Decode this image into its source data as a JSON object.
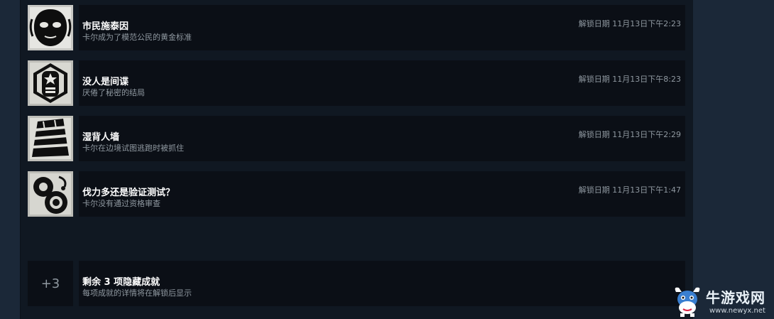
{
  "achievements": [
    {
      "title": "市民施泰因",
      "description": "卡尔成为了模范公民的黄金标准",
      "unlock_date": "解锁日期 11月13日下午2:23",
      "icon": "mask-face-icon"
    },
    {
      "title": "没人是间谍",
      "description": "厌倦了秘密的结局",
      "unlock_date": "解锁日期 11月13日下午8:23",
      "icon": "star-badge-icon"
    },
    {
      "title": "湿背人墙",
      "description": "卡尔在边境试图逃跑时被抓住",
      "unlock_date": "解锁日期 11月13日下午2:29",
      "icon": "striped-wall-icon"
    },
    {
      "title": "伐力多还是验证测试？",
      "description": "卡尔没有通过资格审查",
      "unlock_date": "解锁日期 11月13日下午1:47",
      "icon": "gears-icon"
    }
  ],
  "hidden": {
    "count": "+3",
    "title": "剩余 3 项隐藏成就",
    "description": "每项成就的详情将在解锁后显示"
  },
  "watermark": {
    "brand": "牛游戏网",
    "url": "www.newyx.net",
    "logo": "bull-mascot-icon"
  },
  "colors": {
    "page_bg": "#1b2838",
    "panel_bg": "#101822",
    "row_bg": "#0b0f16",
    "title": "#ffffff",
    "muted": "#8f98a0"
  }
}
